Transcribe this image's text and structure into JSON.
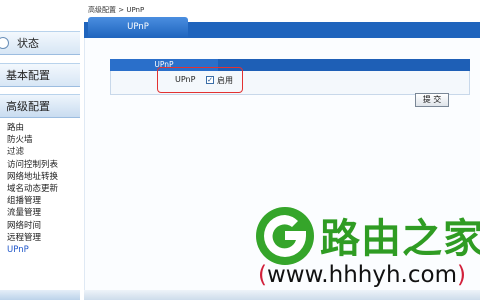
{
  "sidebar": {
    "sections": [
      {
        "label": "状态",
        "active": false
      },
      {
        "label": "基本配置",
        "active": false
      },
      {
        "label": "高级配置",
        "active": true
      }
    ],
    "submenu": [
      {
        "label": "路由"
      },
      {
        "label": "防火墙"
      },
      {
        "label": "过滤"
      },
      {
        "label": "访问控制列表"
      },
      {
        "label": "网络地址转换"
      },
      {
        "label": "域名动态更新"
      },
      {
        "label": "组播管理"
      },
      {
        "label": "流量管理"
      },
      {
        "label": "网络时间"
      },
      {
        "label": "远程管理"
      },
      {
        "label": "UPnP",
        "current": true
      }
    ]
  },
  "breadcrumb": "高级配置 > UPnP",
  "tab": {
    "label": "UPnP"
  },
  "panel": {
    "title": "UPnP",
    "field_label": "UPnP",
    "checkbox_checked": true,
    "enable_label": "启用"
  },
  "submit_label": "提 交",
  "watermark": {
    "title": "路由之家",
    "url_open": "(",
    "url": "www.hhhyh.com",
    "url_close": ")"
  },
  "colors": {
    "tab_blue": "#1f64bd",
    "highlight_red": "#e23232",
    "watermark_green": "#2f9c23"
  }
}
